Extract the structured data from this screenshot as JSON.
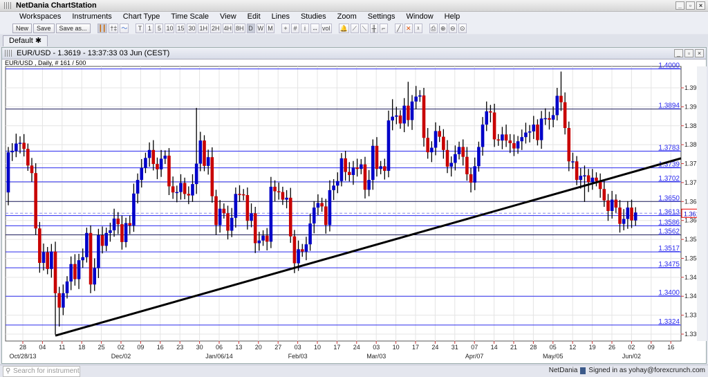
{
  "app": {
    "title": "NetDania ChartStation"
  },
  "menu": [
    "Workspaces",
    "Instruments",
    "Chart Type",
    "Time Scale",
    "View",
    "Edit",
    "Lines",
    "Studies",
    "Zoom",
    "Settings",
    "Window",
    "Help"
  ],
  "toolbar": {
    "new": "New",
    "save": "Save",
    "save_as": "Save as...",
    "chart_types": [
      "candle-icon",
      "bar-icon",
      "line-icon"
    ],
    "timescales": [
      "T",
      "1",
      "5",
      "10",
      "15",
      "30",
      "1H",
      "2H",
      "4H",
      "8H",
      "D",
      "W",
      "M"
    ],
    "selected_timescale": "D",
    "tools": [
      "+",
      "#",
      "i",
      "↔",
      "vol",
      "🔔",
      "⟋",
      "⟍",
      "╫",
      "⌐",
      "╱",
      "✕",
      "ᵡ",
      "⎙",
      "⊕",
      "⊖",
      "⊙"
    ]
  },
  "tabs": [
    {
      "label": "Default",
      "icon": "asterisk-icon"
    }
  ],
  "chart": {
    "window_title": "EUR/USD - 1.3619 - 13:37:33  03 Jun (CEST)",
    "info": "EUR/USD , Daily, # 161 / 500",
    "current_price": "1.3619",
    "colors": {
      "up": "#0000c8",
      "down": "#c80000",
      "level": "#2a2aee",
      "trend": "#000000"
    }
  },
  "chart_data": {
    "type": "candlestick",
    "symbol": "EUR/USD",
    "ylim": [
      1.3285,
      1.401
    ],
    "yticks": [
      "1.3950",
      "1.3900",
      "1.3850",
      "1.3800",
      "1.3750",
      "1.3700",
      "1.3650",
      "1.3600",
      "1.3550",
      "1.3500",
      "1.3450",
      "1.3400",
      "1.3350",
      "1.3300"
    ],
    "xticks": [
      "28",
      "04",
      "11",
      "18",
      "25",
      "02",
      "09",
      "16",
      "23",
      "30",
      "06",
      "13",
      "20",
      "27",
      "03",
      "10",
      "17",
      "24",
      "03",
      "10",
      "17",
      "24",
      "31",
      "07",
      "14",
      "21",
      "28",
      "05",
      "12",
      "19",
      "26",
      "02",
      "09",
      "16"
    ],
    "xmonths": [
      {
        "label": "Oct/28/13",
        "tick": 0
      },
      {
        "label": "Dec/02",
        "tick": 5
      },
      {
        "label": "Jan/06/14",
        "tick": 10
      },
      {
        "label": "Feb/03",
        "tick": 14
      },
      {
        "label": "Mar/03",
        "tick": 18
      },
      {
        "label": "Apr/07",
        "tick": 23
      },
      {
        "label": "May/05",
        "tick": 27
      },
      {
        "label": "Jun/02",
        "tick": 31
      }
    ],
    "first_open": 1.3674,
    "closes": [
      1.378,
      1.3784,
      1.3803,
      1.3805,
      1.3789,
      1.3745,
      1.3725,
      1.3579,
      1.3488,
      1.3516,
      1.3472,
      1.3518,
      1.3408,
      1.337,
      1.3408,
      1.3439,
      1.3485,
      1.3445,
      1.3495,
      1.3503,
      1.3567,
      1.3431,
      1.3474,
      1.3561,
      1.3533,
      1.3567,
      1.3574,
      1.3605,
      1.359,
      1.3543,
      1.3593,
      1.3587,
      1.3671,
      1.3707,
      1.3739,
      1.3765,
      1.3786,
      1.3749,
      1.3735,
      1.3763,
      1.3771,
      1.369,
      1.3674,
      1.3675,
      1.3699,
      1.367,
      1.3666,
      1.3696,
      1.375,
      1.3811,
      1.3744,
      1.3767,
      1.3664,
      1.3588,
      1.3631,
      1.3619,
      1.3573,
      1.3607,
      1.367,
      1.3669,
      1.3667,
      1.3599,
      1.3619,
      1.354,
      1.3547,
      1.356,
      1.3544,
      1.3689,
      1.3677,
      1.3675,
      1.3655,
      1.366,
      1.3558,
      1.3487,
      1.3524,
      1.3518,
      1.3537,
      1.3592,
      1.3634,
      1.3646,
      1.3637,
      1.3588,
      1.368,
      1.3692,
      1.3704,
      1.3764,
      1.3728,
      1.372,
      1.374,
      1.3736,
      1.3748,
      1.3681,
      1.3707,
      1.3797,
      1.3736,
      1.3743,
      1.3731,
      1.3864,
      1.3874,
      1.3877,
      1.3856,
      1.3903,
      1.3865,
      1.3914,
      1.3927,
      1.393,
      1.3818,
      1.378,
      1.3792,
      1.3836,
      1.3821,
      1.3786,
      1.3742,
      1.3752,
      1.3775,
      1.3794,
      1.3768,
      1.3722,
      1.37,
      1.3743,
      1.3794,
      1.3853,
      1.3888,
      1.3885,
      1.3814,
      1.3811,
      1.3827,
      1.3811,
      1.3804,
      1.379,
      1.3809,
      1.382,
      1.3832,
      1.3835,
      1.3853,
      1.3812,
      1.3869,
      1.387,
      1.3866,
      1.3878,
      1.3929,
      1.3912,
      1.3844,
      1.3756,
      1.3756,
      1.3707,
      1.3718,
      1.3719,
      1.3701,
      1.3713,
      1.3704,
      1.3683,
      1.3653,
      1.3625,
      1.3655,
      1.3634,
      1.3591,
      1.3604,
      1.3634,
      1.36,
      1.3621
    ],
    "extremes": [
      {
        "index": 0,
        "low": 1.364
      },
      {
        "index": 12,
        "low": 1.3299
      },
      {
        "index": 13,
        "low": 1.332
      },
      {
        "index": 48,
        "high": 1.3897
      },
      {
        "index": 98,
        "high": 1.392
      },
      {
        "index": 102,
        "high": 1.3966
      },
      {
        "index": 104,
        "high": 1.3955
      },
      {
        "index": 141,
        "high": 1.3993
      },
      {
        "index": 140,
        "high": 1.395
      },
      {
        "index": 147,
        "low": 1.3649
      },
      {
        "index": 159,
        "high": 1.3655
      }
    ],
    "levels": [
      {
        "price": 1.4,
        "label": "1.4000"
      },
      {
        "price": 1.3894,
        "label": "1.3894",
        "dark": true
      },
      {
        "price": 1.3783,
        "label": "1.3783"
      },
      {
        "price": 1.3739,
        "label": "1.3739"
      },
      {
        "price": 1.3702,
        "label": "1.3702"
      },
      {
        "price": 1.365,
        "label": "1.3650",
        "dark": true
      },
      {
        "price": 1.3613,
        "label": "1.3613"
      },
      {
        "price": 1.3586,
        "label": "1.3586"
      },
      {
        "price": 1.3562,
        "label": "1.3562",
        "dark": true
      },
      {
        "price": 1.3517,
        "label": "1.3517"
      },
      {
        "price": 1.3475,
        "label": "1.3475"
      },
      {
        "price": 1.34,
        "label": "1.3400"
      },
      {
        "price": 1.3324,
        "label": "1.3324"
      }
    ],
    "trendline": {
      "from": {
        "index": 12,
        "price": 1.3296
      },
      "to_price_at_right_edge": 1.3764
    }
  },
  "status": {
    "search_placeholder": "Search for instrument",
    "brand": "NetDania",
    "signed_in": "Signed in as yohay@forexcrunch.com"
  }
}
